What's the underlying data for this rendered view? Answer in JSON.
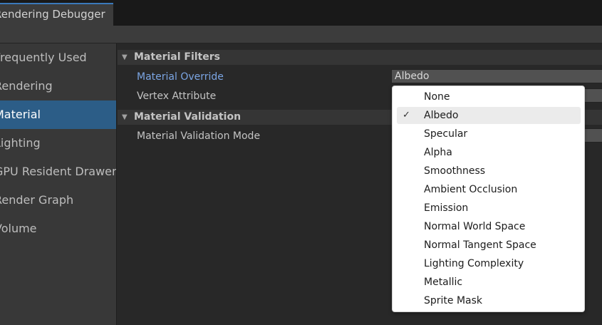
{
  "window": {
    "tab_title": "Rendering Debugger"
  },
  "sidebar": {
    "items": [
      {
        "label": "Frequently Used"
      },
      {
        "label": "Rendering"
      },
      {
        "label": "Material"
      },
      {
        "label": "Lighting"
      },
      {
        "label": "GPU Resident Drawer"
      },
      {
        "label": "Render Graph"
      },
      {
        "label": "Volume"
      }
    ],
    "selected": "Material"
  },
  "content": {
    "material_filters": {
      "title": "Material Filters",
      "material_override_label": "Material Override",
      "material_override_value": "Albedo",
      "vertex_attribute_label": "Vertex Attribute"
    },
    "material_validation": {
      "title": "Material Validation",
      "mode_label": "Material Validation Mode"
    }
  },
  "dropdown": {
    "check_glyph": "✓",
    "selected": "Albedo",
    "options": [
      "None",
      "Albedo",
      "Specular",
      "Alpha",
      "Smoothness",
      "Ambient Occlusion",
      "Emission",
      "Normal World Space",
      "Normal Tangent Space",
      "Lighting Complexity",
      "Metallic",
      "Sprite Mask"
    ]
  },
  "colors": {
    "accent": "#3a79bb",
    "selected_sidebar": "#2c5d87",
    "active_label": "#7ba5e3"
  }
}
